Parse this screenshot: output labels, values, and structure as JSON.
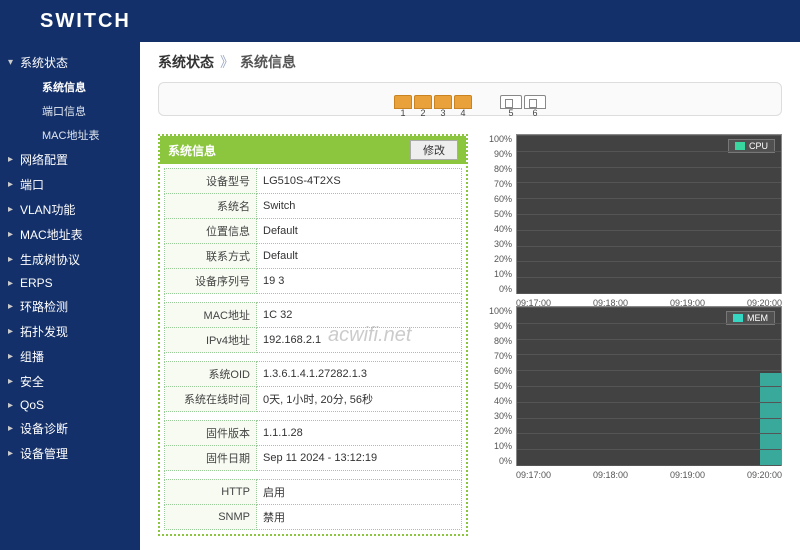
{
  "brand": "SWITCH",
  "breadcrumb": {
    "root": "系统状态",
    "current": "系统信息"
  },
  "sidebar": {
    "items": [
      {
        "label": "系统状态",
        "expanded": true,
        "children": [
          {
            "label": "系统信息",
            "active": true
          },
          {
            "label": "端口信息"
          },
          {
            "label": "MAC地址表"
          }
        ]
      },
      {
        "label": "网络配置"
      },
      {
        "label": "端口"
      },
      {
        "label": "VLAN功能"
      },
      {
        "label": "MAC地址表"
      },
      {
        "label": "生成树协议"
      },
      {
        "label": "ERPS"
      },
      {
        "label": "环路检测"
      },
      {
        "label": "拓扑发现"
      },
      {
        "label": "组播"
      },
      {
        "label": "安全"
      },
      {
        "label": "QoS"
      },
      {
        "label": "设备诊断"
      },
      {
        "label": "设备管理"
      }
    ]
  },
  "ports": {
    "rj": [
      "1",
      "2",
      "3",
      "4"
    ],
    "sfp": [
      "5",
      "6"
    ]
  },
  "sysinfo": {
    "title": "系统信息",
    "modify_btn": "修改",
    "rows": [
      {
        "k": "设备型号",
        "v": "LG510S-4T2XS"
      },
      {
        "k": "系统名",
        "v": "Switch"
      },
      {
        "k": "位置信息",
        "v": "Default"
      },
      {
        "k": "联系方式",
        "v": "Default"
      },
      {
        "k": "设备序列号",
        "v": "19                     3"
      }
    ],
    "rows2": [
      {
        "k": "MAC地址",
        "v": "1C                   32"
      },
      {
        "k": "IPv4地址",
        "v": "192.168.2.1"
      }
    ],
    "rows3": [
      {
        "k": "系统OID",
        "v": "1.3.6.1.4.1.27282.1.3"
      },
      {
        "k": "系统在线时间",
        "v": "0天, 1小时, 20分, 56秒"
      }
    ],
    "rows4": [
      {
        "k": "固件版本",
        "v": "1.1.1.28"
      },
      {
        "k": "固件日期",
        "v": "Sep 11 2024 - 13:12:19"
      }
    ],
    "rows5": [
      {
        "k": "HTTP",
        "v": "启用"
      },
      {
        "k": "SNMP",
        "v": "禁用"
      }
    ]
  },
  "chart_data": [
    {
      "type": "line",
      "title": "",
      "legend": "CPU",
      "legend_color": "#3ad6a0",
      "ylabel": "%",
      "ylim": [
        0,
        100
      ],
      "yticks": [
        0,
        10,
        20,
        30,
        40,
        50,
        60,
        70,
        80,
        90,
        100
      ],
      "x": [
        "09:17:00",
        "09:18:00",
        "09:19:00",
        "09:20:00"
      ],
      "series": [
        {
          "name": "CPU",
          "values": [
            0,
            0,
            0,
            0
          ]
        }
      ]
    },
    {
      "type": "area",
      "title": "",
      "legend": "MEM",
      "legend_color": "#36d6c3",
      "ylabel": "%",
      "ylim": [
        0,
        100
      ],
      "yticks": [
        0,
        10,
        20,
        30,
        40,
        50,
        60,
        70,
        80,
        90,
        100
      ],
      "x": [
        "09:17:00",
        "09:18:00",
        "09:19:00",
        "09:20:00"
      ],
      "series": [
        {
          "name": "MEM",
          "values": [
            null,
            null,
            null,
            58
          ]
        }
      ]
    }
  ],
  "watermark": "acwifi.net"
}
